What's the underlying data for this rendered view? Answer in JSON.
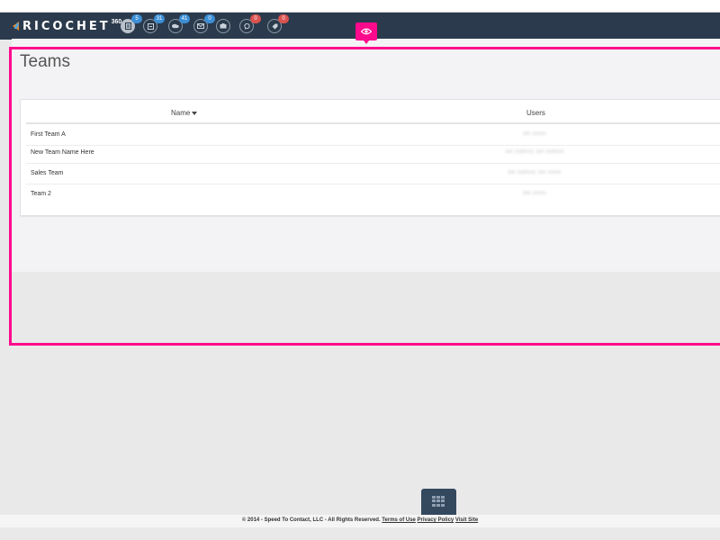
{
  "brand": {
    "name": "RICOCHET",
    "superscript": "360"
  },
  "nav": {
    "icons": [
      {
        "icon": "document-icon",
        "badge": "5",
        "badge_color": "#3b8fd6"
      },
      {
        "icon": "list-icon",
        "badge": "31",
        "badge_color": "#3b8fd6"
      },
      {
        "icon": "chat-icon",
        "badge": "41",
        "badge_color": "#3b8fd6"
      },
      {
        "icon": "mail-icon",
        "badge": "0",
        "badge_color": "#3b8fd6"
      },
      {
        "icon": "inbox-icon",
        "badge": "",
        "badge_color": ""
      },
      {
        "icon": "comment-icon",
        "badge": "0",
        "badge_color": "#d9534f"
      },
      {
        "icon": "tag-icon",
        "badge": "0",
        "badge_color": "#d9534f"
      }
    ]
  },
  "page": {
    "title": "Teams"
  },
  "table": {
    "columns": {
      "name": "Name",
      "users": "Users"
    },
    "rows": [
      {
        "name": "First Team A",
        "users": "Bill Jones"
      },
      {
        "name": "New Team Name Here",
        "users": "Bill Stafford, Bill Stafford"
      },
      {
        "name": "Sales Team",
        "users": "Bill Stafford, Bill Jones"
      },
      {
        "name": "Team 2",
        "users": "Bill Jones"
      }
    ]
  },
  "footer": {
    "copyright": "© 2014 - Speed To Contact, LLC - All Rights Reserved.",
    "terms": "Terms of Use",
    "privacy": "Privacy Policy",
    "visit": "Visit Site"
  },
  "colors": {
    "topbar": "#2b3a4c",
    "highlight": "#ff0a8c",
    "accent_blue": "#3b8fd6",
    "accent_red": "#d9534f"
  }
}
